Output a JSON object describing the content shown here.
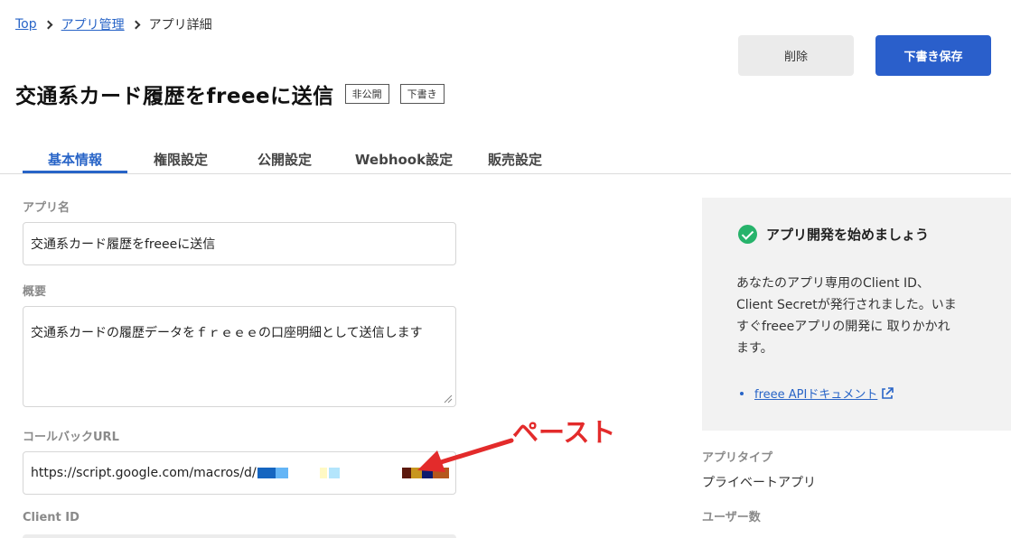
{
  "breadcrumb": {
    "top": "Top",
    "app_management": "アプリ管理",
    "current": "アプリ詳細"
  },
  "header": {
    "delete_label": "削除",
    "save_draft_label": "下書き保存"
  },
  "page": {
    "title": "交通系カード履歴をfreeeに送信",
    "badge_private": "非公開",
    "badge_draft": "下書き"
  },
  "tabs": [
    {
      "label": "基本情報",
      "active": true
    },
    {
      "label": "権限設定",
      "active": false
    },
    {
      "label": "公開設定",
      "active": false
    },
    {
      "label": "Webhook設定",
      "active": false
    },
    {
      "label": "販売設定",
      "active": false
    }
  ],
  "form": {
    "app_name_label": "アプリ名",
    "app_name_value": "交通系カード履歴をfreeeに送信",
    "summary_label": "概要",
    "summary_value": "交通系カードの履歴データをｆｒｅｅｅの口座明細として送信します",
    "callback_label": "コールバックURL",
    "callback_value": "https://script.google.com/macros/d/",
    "client_id_label": "Client ID"
  },
  "info_panel": {
    "heading": "アプリ開発を始めましょう",
    "body": "あなたのアプリ専用のClient ID、Client Secretが発行されました。いますぐfreeeアプリの開発に 取りかかれます。",
    "doc_link": "freee APIドキュメント"
  },
  "meta": {
    "app_type_label": "アプリタイプ",
    "app_type_value": "プライベートアプリ",
    "user_count_label": "ユーザー数"
  },
  "annotation": {
    "text": "ペースト",
    "color": "#e32b2b"
  },
  "colors": {
    "accent": "#2864c7",
    "primary_button": "#2a5fcb",
    "success": "#27b36b"
  }
}
